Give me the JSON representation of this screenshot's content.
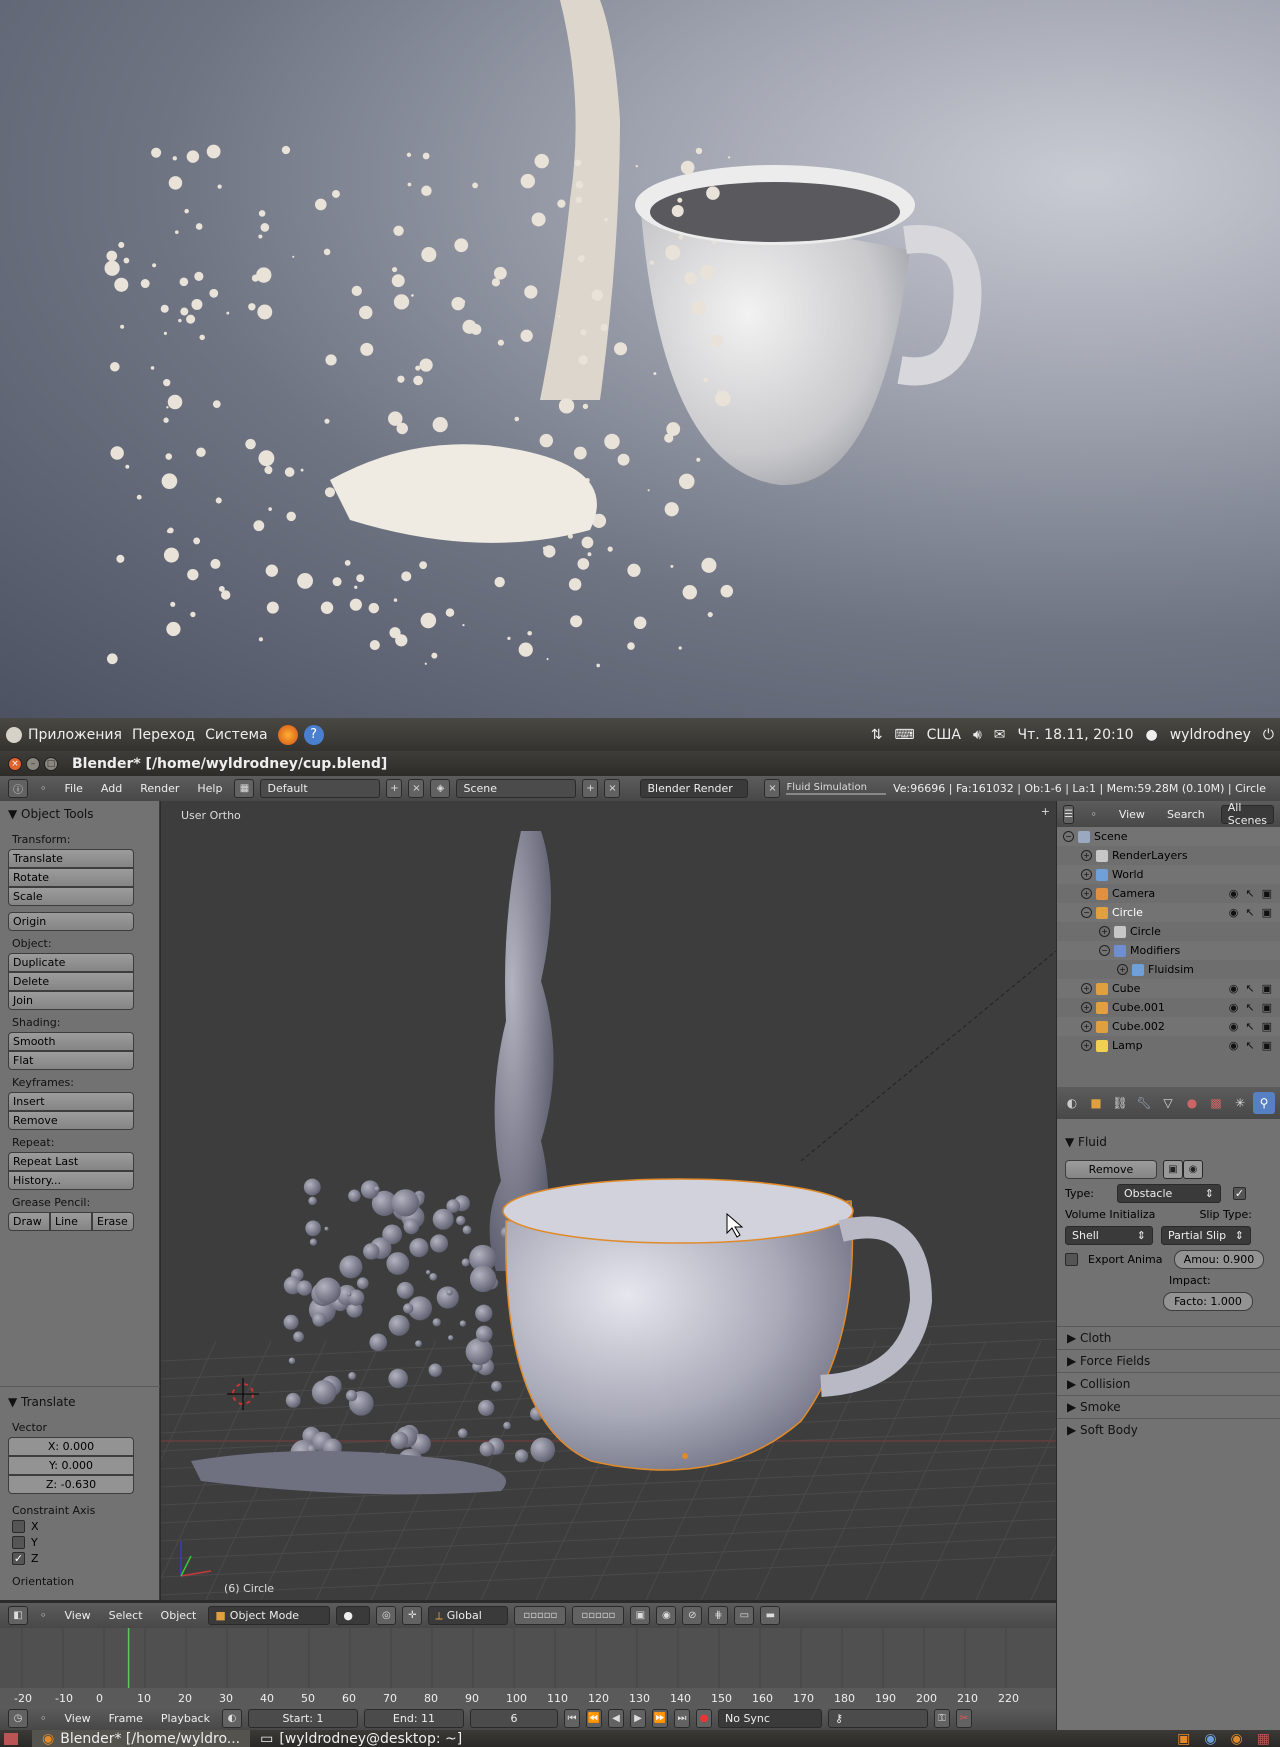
{
  "gnome_panel": {
    "menus": [
      "Приложения",
      "Переход",
      "Система"
    ],
    "keyboard": "США",
    "datetime": "Чт. 18.11, 20:10",
    "user": "wyldrodney"
  },
  "window": {
    "title": "Blender* [/home/wyldrodney/cup.blend]"
  },
  "info_header": {
    "menus": [
      "File",
      "Add",
      "Render",
      "Help"
    ],
    "layout": "Default",
    "scene": "Scene",
    "engine": "Blender Render",
    "job": "Fluid Simulation",
    "stats": "Ve:96696 | Fa:161032 | Ob:1-6 | La:1 | Mem:59.28M (0.10M) | Circle"
  },
  "tool_shelf": {
    "title": "Object Tools",
    "transform_label": "Transform:",
    "transform": [
      "Translate",
      "Rotate",
      "Scale"
    ],
    "origin": "Origin",
    "object_label": "Object:",
    "object": [
      "Duplicate",
      "Delete",
      "Join"
    ],
    "shading_label": "Shading:",
    "shading": [
      "Smooth",
      "Flat"
    ],
    "keyframes_label": "Keyframes:",
    "keyframes": [
      "Insert",
      "Remove"
    ],
    "repeat_label": "Repeat:",
    "repeat": [
      "Repeat Last",
      "History..."
    ],
    "grease_label": "Grease Pencil:",
    "grease": [
      "Draw",
      "Line",
      "Erase"
    ]
  },
  "operator_panel": {
    "title": "Translate",
    "vector_label": "Vector",
    "x": "X: 0.000",
    "y": "Y: 0.000",
    "z": "Z: -0.630",
    "constraint_label": "Constraint Axis",
    "axes": [
      {
        "label": "X",
        "checked": false
      },
      {
        "label": "Y",
        "checked": false
      },
      {
        "label": "Z",
        "checked": true
      }
    ],
    "orientation_label": "Orientation"
  },
  "viewport": {
    "view_name": "User Ortho",
    "object_name": "(6) Circle"
  },
  "view_footer": {
    "menus": [
      "View",
      "Select",
      "Object"
    ],
    "mode": "Object Mode",
    "orientation": "Global"
  },
  "timeline": {
    "ticks": [
      "-20",
      "-10",
      "0",
      "10",
      "20",
      "30",
      "40",
      "50",
      "60",
      "70",
      "80",
      "90",
      "100",
      "110",
      "120",
      "130",
      "140",
      "150",
      "160",
      "170",
      "180",
      "190",
      "200",
      "210",
      "220"
    ],
    "current_frame_value": 6,
    "menus": [
      "View",
      "Frame",
      "Playback"
    ],
    "start": "Start: 1",
    "end": "End: 11",
    "current": "6",
    "sync": "No Sync"
  },
  "outliner": {
    "menus": [
      "View",
      "Search"
    ],
    "filter": "All Scenes",
    "items": [
      {
        "label": "Scene",
        "indent": 0,
        "icon_color": "#9aa9c0"
      },
      {
        "label": "RenderLayers",
        "indent": 1,
        "icon_color": "#c7c7c7"
      },
      {
        "label": "World",
        "indent": 1,
        "icon_color": "#6fa0d8"
      },
      {
        "label": "Camera",
        "indent": 1,
        "icon_color": "#e09040"
      },
      {
        "label": "Circle",
        "indent": 1,
        "icon_color": "#e0a040",
        "highlight": true
      },
      {
        "label": "Circle",
        "indent": 2,
        "icon_color": "#c7c7c7"
      },
      {
        "label": "Modifiers",
        "indent": 2,
        "icon_color": "#6f8fd0"
      },
      {
        "label": "Fluidsim",
        "indent": 3,
        "icon_color": "#6fa0d8"
      },
      {
        "label": "Cube",
        "indent": 1,
        "icon_color": "#e0a040"
      },
      {
        "label": "Cube.001",
        "indent": 1,
        "icon_color": "#e0a040"
      },
      {
        "label": "Cube.002",
        "indent": 1,
        "icon_color": "#e0a040"
      },
      {
        "label": "Lamp",
        "indent": 1,
        "icon_color": "#f0d050"
      }
    ]
  },
  "properties": {
    "panel": "Fluid",
    "remove": "Remove",
    "type_label": "Type:",
    "type_value": "Obstacle",
    "volume_label": "Volume Initializa",
    "slip_label": "Slip Type:",
    "volume_value": "Shell",
    "slip_value": "Partial Slip",
    "export_label": "Export Anima",
    "amount": "Amou: 0.900",
    "impact_label": "Impact:",
    "factor": "Facto: 1.000",
    "collapsed": [
      "Cloth",
      "Force Fields",
      "Collision",
      "Smoke",
      "Soft Body"
    ]
  },
  "taskbar": {
    "items": [
      "Blender* [/home/wyldro...",
      "[wyldrodney@desktop: ~]"
    ]
  },
  "colors": {
    "accent": "#5680c2",
    "selection_outline": "#e08a2a"
  }
}
